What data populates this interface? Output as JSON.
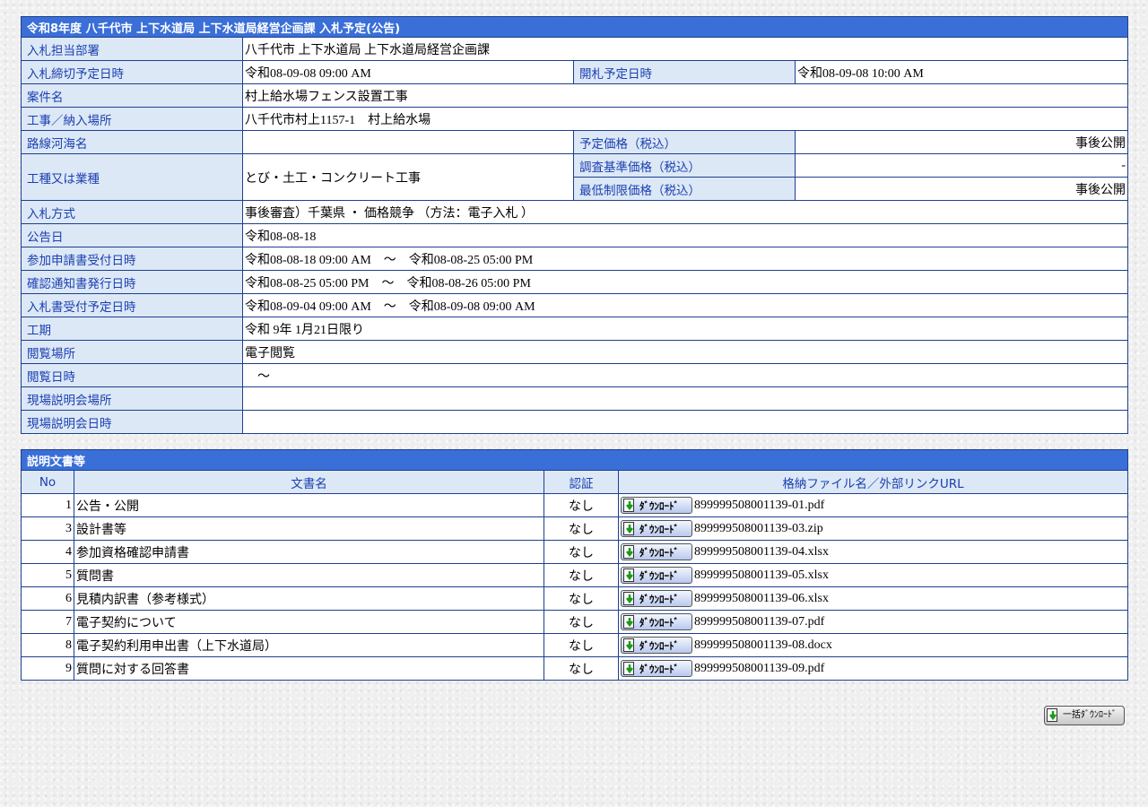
{
  "info": {
    "title": "令和8年度 八千代市 上下水道局 上下水道局経営企画課 入札予定(公告)",
    "rows": {
      "dept_label": "入札担当部署",
      "dept_value": "八千代市 上下水道局 上下水道局経営企画課",
      "deadline_label": "入札締切予定日時",
      "deadline_value": "令和08-09-08 09:00 AM",
      "opening_label": "開札予定日時",
      "opening_value": "令和08-09-08 10:00 AM",
      "case_label": "案件名",
      "case_value": "村上給水場フェンス設置工事",
      "place_label": "工事／納入場所",
      "place_value": "八千代市村上1157-1　村上給水場",
      "route_label": "路線河海名",
      "route_value": "",
      "planned_price_label": "予定価格（税込）",
      "planned_price_value": "事後公開",
      "work_type_label": "工種又は業種",
      "work_type_value": "とび・土工・コンクリート工事",
      "survey_price_label": "調査基準価格（税込）",
      "survey_price_value": "-",
      "min_price_label": "最低制限価格（税込）",
      "min_price_value": "事後公開",
      "method_label": "入札方式",
      "method_value": "事後審査）千葉県 ・ 価格競争 （方法：電子入札 ）",
      "notice_date_label": "公告日",
      "notice_date_value": "令和08-08-18",
      "application_label": "参加申請書受付日時",
      "application_value": "令和08-08-18 09:00 AM　～　令和08-08-25 05:00 PM",
      "confirm_label": "確認通知書発行日時",
      "confirm_value": "令和08-08-25 05:00 PM　～　令和08-08-26 05:00 PM",
      "bid_receipt_label": "入札書受付予定日時",
      "bid_receipt_value": "令和08-09-04 09:00 AM　～　令和08-09-08 09:00 AM",
      "period_label": "工期",
      "period_value": "令和 9年 1月21日限り",
      "view_place_label": "閲覧場所",
      "view_place_value": "電子閲覧",
      "view_date_label": "閲覧日時",
      "view_date_value": "　～",
      "site_place_label": "現場説明会場所",
      "site_place_value": "",
      "site_date_label": "現場説明会日時",
      "site_date_value": ""
    }
  },
  "docs": {
    "title": "説明文書等",
    "headers": {
      "no": "No",
      "name": "文書名",
      "auth": "認証",
      "file": "格納ファイル名／外部リンクURL"
    },
    "download_label": "ﾀﾞｳﾝﾛｰﾄﾞ",
    "rows": [
      {
        "no": "1",
        "name": "公告・公開",
        "auth": "なし",
        "file": "899999508001139-01.pdf"
      },
      {
        "no": "3",
        "name": "設計書等",
        "auth": "なし",
        "file": "899999508001139-03.zip"
      },
      {
        "no": "4",
        "name": "参加資格確認申請書",
        "auth": "なし",
        "file": "899999508001139-04.xlsx"
      },
      {
        "no": "5",
        "name": "質問書",
        "auth": "なし",
        "file": "899999508001139-05.xlsx"
      },
      {
        "no": "6",
        "name": "見積内訳書（参考様式）",
        "auth": "なし",
        "file": "899999508001139-06.xlsx"
      },
      {
        "no": "7",
        "name": "電子契約について",
        "auth": "なし",
        "file": "899999508001139-07.pdf"
      },
      {
        "no": "8",
        "name": "電子契約利用申出書（上下水道局）",
        "auth": "なし",
        "file": "899999508001139-08.docx"
      },
      {
        "no": "9",
        "name": "質問に対する回答書",
        "auth": "なし",
        "file": "899999508001139-09.pdf"
      }
    ],
    "bulk_download_label": "一括ﾀﾞｳﾝﾛｰﾄﾞ"
  },
  "colors": {
    "title_bg": "#3a6fd8",
    "label_bg": "#dce8f6",
    "label_text": "#1b3fb0",
    "border": "#1e3f8f"
  },
  "icons": {
    "download": "download-arrow-icon"
  }
}
